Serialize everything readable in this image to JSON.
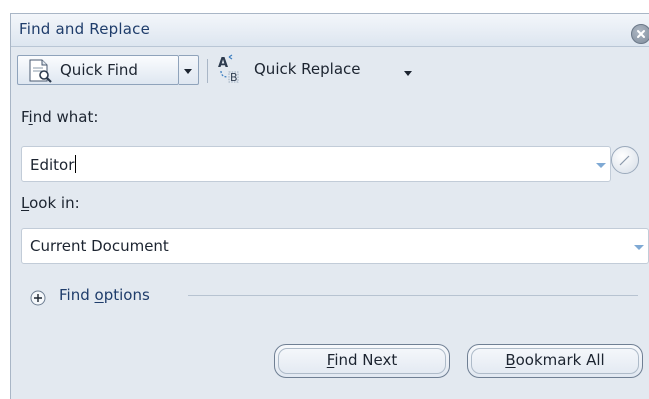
{
  "window": {
    "title": "Find and Replace",
    "close_icon": "close-icon"
  },
  "toolbar": {
    "quick_find_label": "Quick Find",
    "quick_replace_label": "Quick Replace",
    "quick_find_icon": "document-search-icon",
    "quick_replace_icon": "replace-icon"
  },
  "find_what": {
    "label_prefix": "F",
    "label_accel": "i",
    "label_suffix": "nd what:",
    "value": "Editor"
  },
  "look_in": {
    "label_accel": "L",
    "label_suffix": "ook in:",
    "value": "Current Document"
  },
  "find_options": {
    "label_prefix": "Find ",
    "label_accel": "o",
    "label_suffix": "ptions"
  },
  "buttons": {
    "find_next": {
      "accel": "F",
      "rest": "ind Next"
    },
    "bookmark_all": {
      "accel": "B",
      "rest": "ookmark All"
    }
  },
  "colors": {
    "panel_bg": "#e3e9f0",
    "title_text": "#1f3d6b",
    "accent_arrow": "#7fa9d4"
  }
}
